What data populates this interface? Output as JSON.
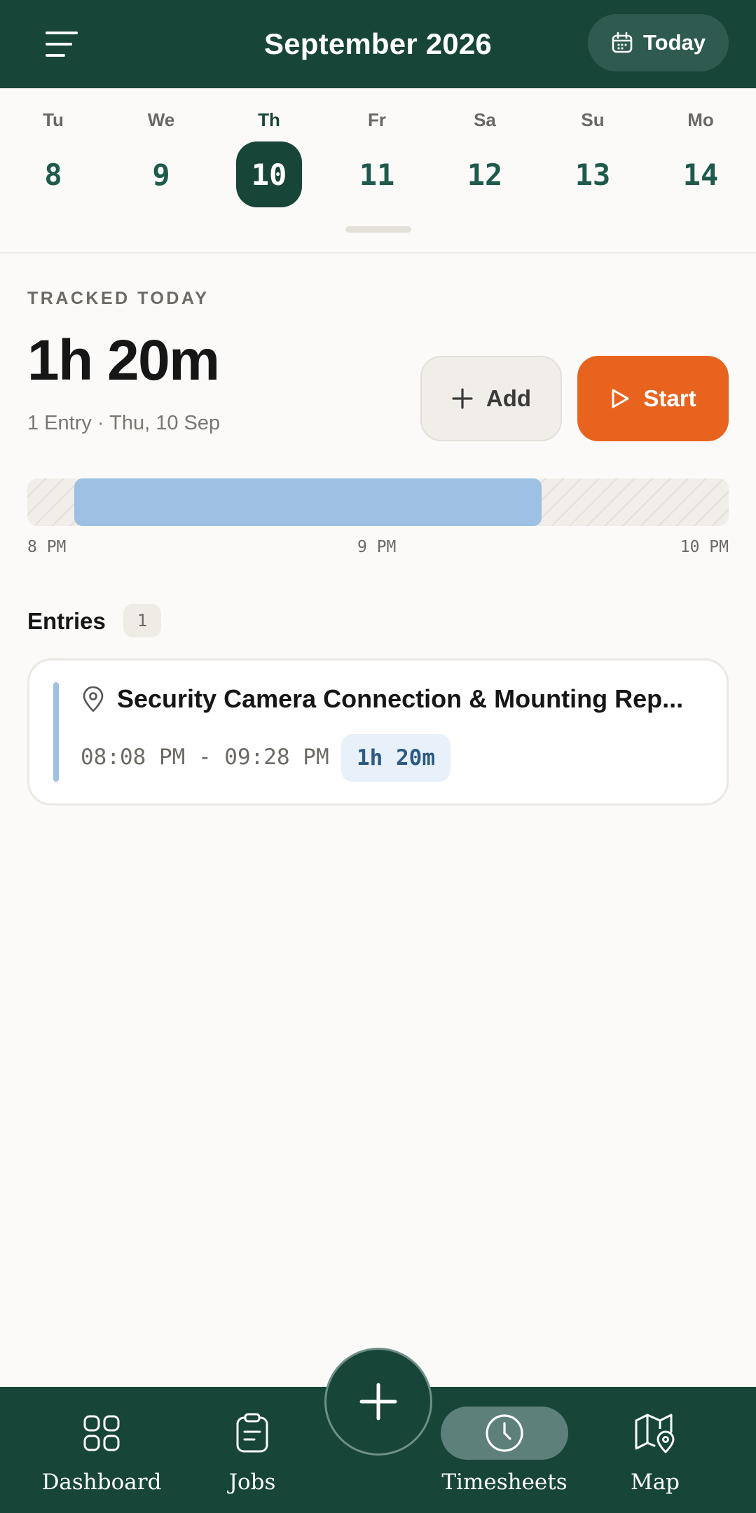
{
  "header": {
    "title": "September 2026",
    "today_label": "Today"
  },
  "week": {
    "days": [
      {
        "name": "Tu",
        "num": "8",
        "selected": false
      },
      {
        "name": "We",
        "num": "9",
        "selected": false
      },
      {
        "name": "Th",
        "num": "10",
        "selected": true
      },
      {
        "name": "Fr",
        "num": "11",
        "selected": false
      },
      {
        "name": "Sa",
        "num": "12",
        "selected": false
      },
      {
        "name": "Su",
        "num": "13",
        "selected": false
      },
      {
        "name": "Mo",
        "num": "14",
        "selected": false
      }
    ]
  },
  "tracked": {
    "label": "TRACKED TODAY",
    "total": "1h 20m",
    "subtitle": "1 Entry · Thu, 10 Sep",
    "add_label": "Add",
    "start_label": "Start"
  },
  "timeline": {
    "ticks": [
      "8 PM",
      "9 PM",
      "10 PM"
    ],
    "range_start": "20:00",
    "range_end": "22:00",
    "block_start": "20:08",
    "block_end": "21:28"
  },
  "entries": {
    "title": "Entries",
    "count": "1",
    "items": [
      {
        "title": "Security Camera Connection & Mounting Rep...",
        "time_range": "08:08 PM - 09:28 PM",
        "duration": "1h 20m"
      }
    ]
  },
  "nav": {
    "items": [
      {
        "label": "Dashboard",
        "icon": "dashboard-icon",
        "active": false
      },
      {
        "label": "Jobs",
        "icon": "clipboard-icon",
        "active": false
      },
      {
        "label": "Timesheets",
        "icon": "clock-icon",
        "active": true
      },
      {
        "label": "Map",
        "icon": "map-pin-icon",
        "active": false
      }
    ],
    "fab_icon": "plus-icon"
  },
  "colors": {
    "brand": "#174538",
    "accent": "#e8641e",
    "entry_accent": "#9ec0e3",
    "background": "#fbfaf8"
  }
}
